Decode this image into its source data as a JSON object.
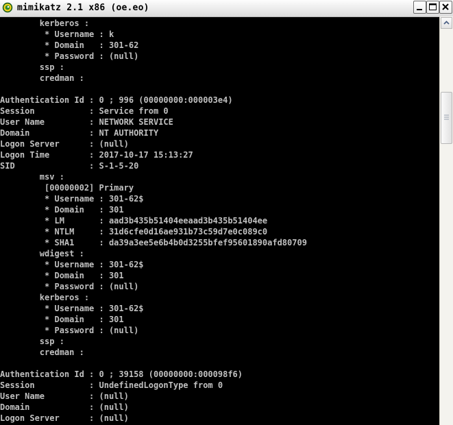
{
  "window": {
    "title": "mimikatz 2.1 x86 (oe.eo)",
    "icon": "mimikatz-app-icon",
    "controls": {
      "minimize_icon": "minimize-icon",
      "maximize_icon": "maximize-icon",
      "close_icon": "close-icon"
    }
  },
  "colors": {
    "console_bg": "#000000",
    "console_text": "#c0c0c0",
    "titlebar": "#ececec"
  },
  "console": {
    "lines": [
      "        kerberos :",
      "         * Username : k",
      "         * Domain   : 301-62",
      "         * Password : (null)",
      "        ssp :",
      "        credman :",
      "",
      "Authentication Id : 0 ; 996 (00000000:000003e4)",
      "Session           : Service from 0",
      "User Name         : NETWORK SERVICE",
      "Domain            : NT AUTHORITY",
      "Logon Server      : (null)",
      "Logon Time        : 2017-10-17 15:13:27",
      "SID               : S-1-5-20",
      "        msv :",
      "         [00000002] Primary",
      "         * Username : 301-62$",
      "         * Domain   : 301",
      "         * LM       : aad3b435b51404eeaad3b435b51404ee",
      "         * NTLM     : 31d6cfe0d16ae931b73c59d7e0c089c0",
      "         * SHA1     : da39a3ee5e6b4b0d3255bfef95601890afd80709",
      "        wdigest :",
      "         * Username : 301-62$",
      "         * Domain   : 301",
      "         * Password : (null)",
      "        kerberos :",
      "         * Username : 301-62$",
      "         * Domain   : 301",
      "         * Password : (null)",
      "        ssp :",
      "        credman :",
      "",
      "Authentication Id : 0 ; 39158 (00000000:000098f6)",
      "Session           : UndefinedLogonType from 0",
      "User Name         : (null)",
      "Domain            : (null)",
      "Logon Server      : (null)"
    ]
  },
  "scrollbar": {
    "up_icon": "scroll-up-arrow-icon"
  }
}
